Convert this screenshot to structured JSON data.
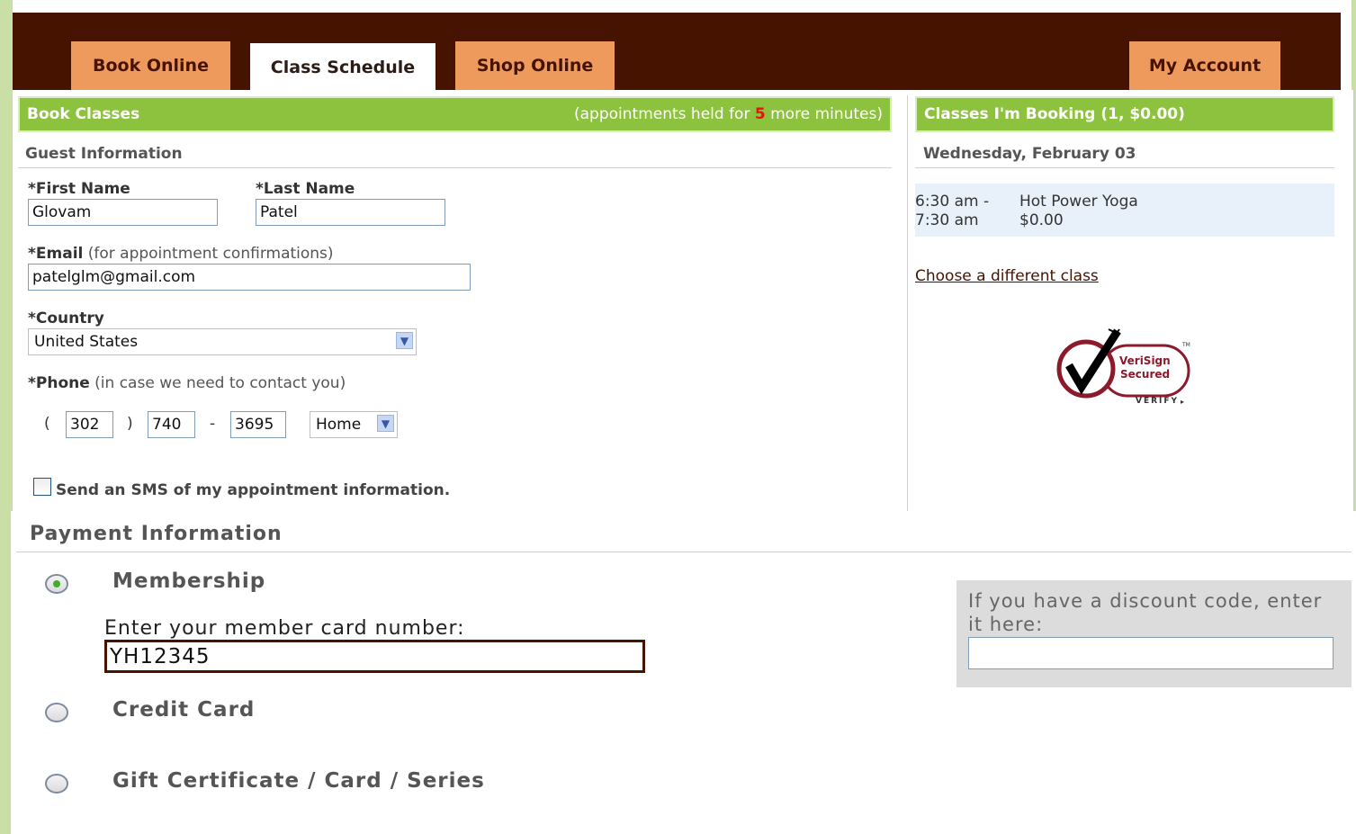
{
  "tabs": {
    "book_online": "Book Online",
    "class_schedule": "Class Schedule",
    "shop_online": "Shop Online",
    "my_account": "My Account"
  },
  "book_classes": {
    "title": "Book Classes",
    "held_prefix": "(appointments held for ",
    "held_minutes": "5",
    "held_suffix": " more minutes)"
  },
  "guest": {
    "section_title": "Guest Information",
    "first_name_label": "*First Name",
    "first_name_value": "Glovam",
    "last_name_label": "*Last Name",
    "last_name_value": "Patel",
    "email_label": "*Email",
    "email_note": "(for appointment confirmations)",
    "email_value": "patelglm@gmail.com",
    "country_label": "*Country",
    "country_value": "United States",
    "phone_label": "*Phone",
    "phone_note": "(in case we need to contact you)",
    "phone_open": "(",
    "phone_area": "302",
    "phone_close": ")",
    "phone_prefix": "740",
    "phone_dash": "-",
    "phone_line": "3695",
    "phone_type": "Home",
    "sms_label": "Send an SMS of my appointment information."
  },
  "booking": {
    "title": "Classes I'm Booking (1, $0.00)",
    "date": "Wednesday, February 03",
    "time_start": "6:30 am -",
    "time_end": "7:30 am",
    "class_name": "Hot Power Yoga",
    "class_price": "$0.00",
    "choose_link": "Choose a different class",
    "seal_line1": "VeriSign",
    "seal_line2": "Secured",
    "seal_verify": "VERIFY",
    "seal_tm": "TM"
  },
  "payment": {
    "section_title": "Payment Information",
    "membership_label": "Membership",
    "member_card_label": "Enter your member card number:",
    "member_card_value": "YH12345",
    "credit_card_label": "Credit Card",
    "gift_label": "Gift Certificate / Card / Series",
    "discount_label": "If you have a discount code, enter it here:",
    "discount_value": ""
  },
  "colors": {
    "header_brown": "#461300",
    "tab_orange": "#ee9a5c",
    "bar_green": "#8dc23e",
    "highlight_red": "#e8110c",
    "link_brown": "#461300"
  }
}
